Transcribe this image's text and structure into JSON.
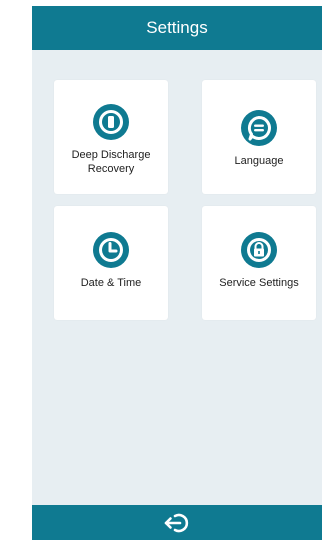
{
  "header": {
    "title": "Settings"
  },
  "tiles": [
    {
      "label": "Deep Discharge\nRecovery",
      "icon": "battery-icon"
    },
    {
      "label": "Language",
      "icon": "speech-bubble-icon"
    },
    {
      "label": "Date & Time",
      "icon": "clock-icon"
    },
    {
      "label": "Service Settings",
      "icon": "lock-icon"
    }
  ],
  "footer": {
    "back_icon": "back-arrow-icon"
  },
  "colors": {
    "accent": "#0f7a91",
    "background": "#e7eef2",
    "tile": "#ffffff"
  }
}
